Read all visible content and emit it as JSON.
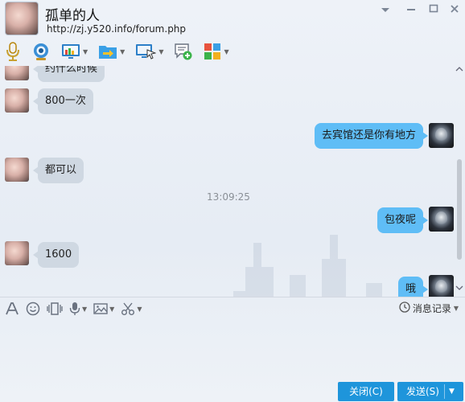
{
  "header": {
    "contact_name": "孤单的人",
    "url": "http://zj.y520.info/forum.php"
  },
  "window_controls": {
    "menu_icon": "chevron-down-icon",
    "minimize_icon": "minimize-icon",
    "maximize_icon": "maximize-icon",
    "close_icon": "close-icon"
  },
  "toolbar": {
    "icons": [
      "microphone-icon",
      "video-call-icon",
      "screen-share-icon",
      "file-transfer-icon",
      "remote-assist-icon",
      "sms-icon",
      "apps-icon"
    ]
  },
  "chat": {
    "partial_top_message": "约什么时候",
    "messages": [
      {
        "side": "left",
        "text": "800一次"
      },
      {
        "side": "right",
        "text": "去宾馆还是你有地方"
      },
      {
        "side": "left",
        "text": "都可以"
      },
      {
        "side": "right",
        "text": "包夜呢"
      },
      {
        "side": "left",
        "text": "1600"
      },
      {
        "side": "right",
        "text": "哦"
      }
    ],
    "timestamp": "13:09:25"
  },
  "input_toolbar": {
    "icons": [
      "font-icon",
      "emoji-icon",
      "shake-icon",
      "voice-icon",
      "image-icon",
      "screenshot-icon"
    ],
    "history_label": "消息记录"
  },
  "buttons": {
    "close_label": "关闭(C)",
    "send_label": "发送(S)"
  },
  "colors": {
    "accent": "#1e95db",
    "bubble_right": "#5fbdf6",
    "bubble_left": "#cfd8e2"
  }
}
